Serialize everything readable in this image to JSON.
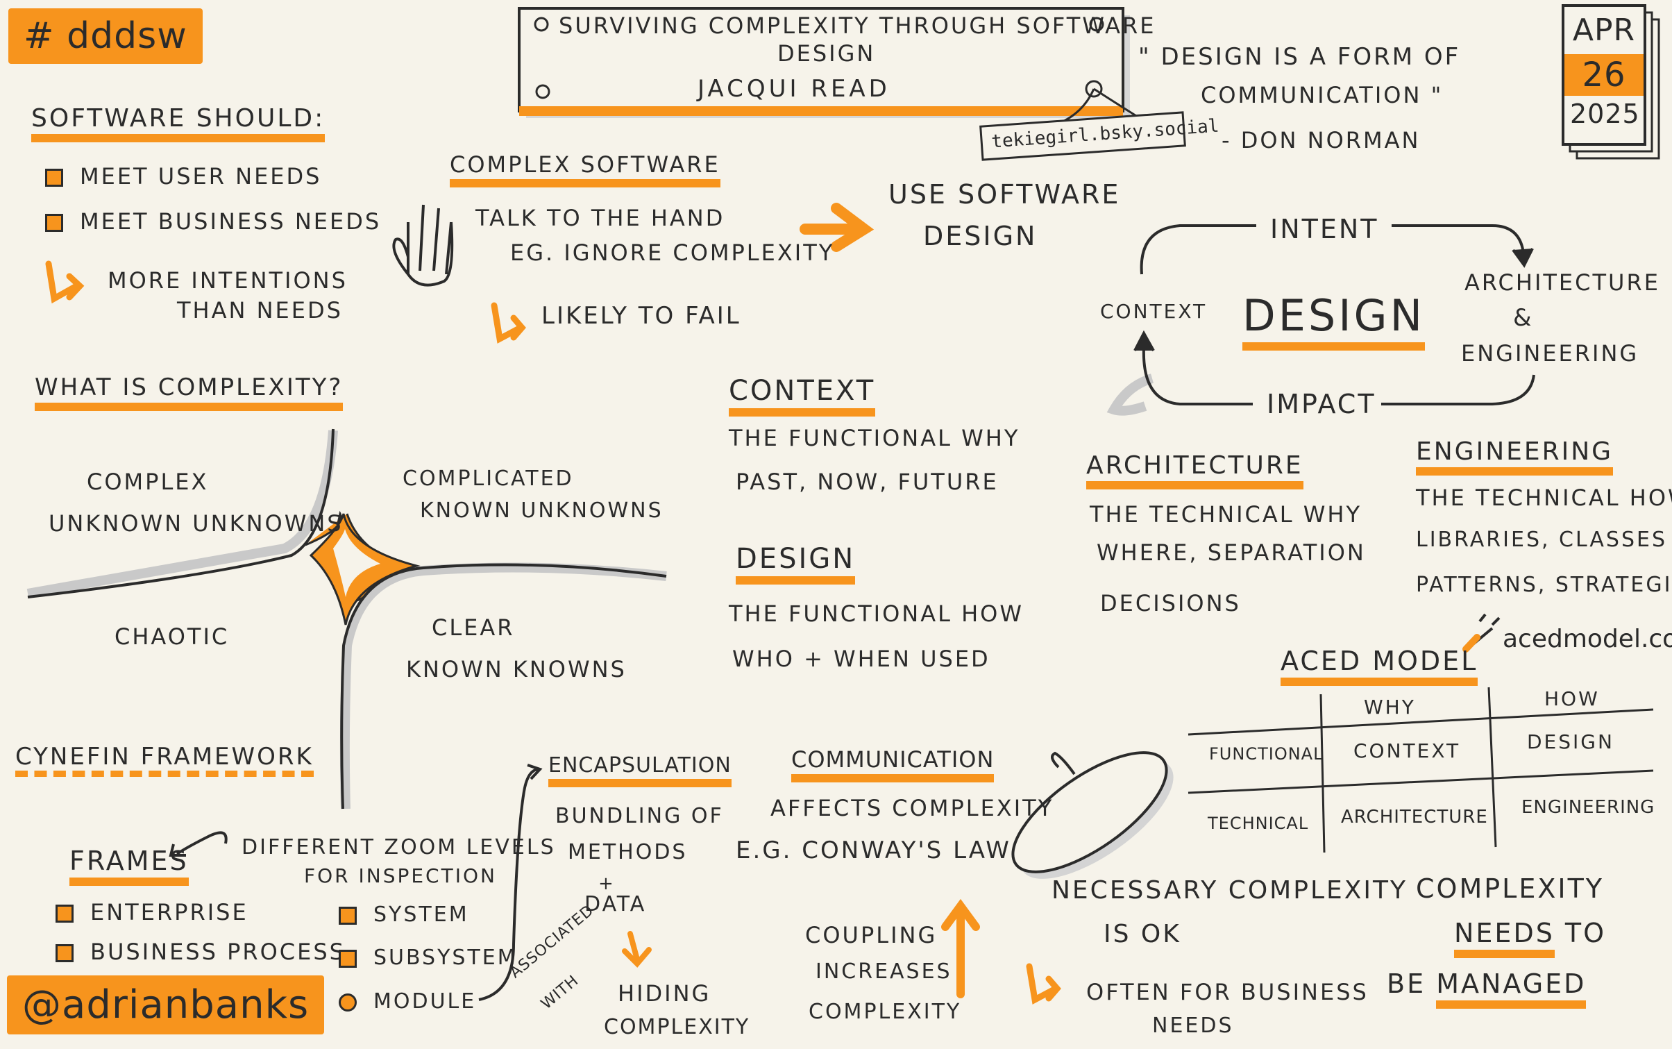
{
  "hashtag": "# dddsw",
  "handle": "@adrianbanks",
  "title": {
    "line1": "Surviving complexity through software",
    "line2": "design",
    "speaker": "Jacqui Read",
    "speaker_handle": "tekiegirl.bsky.social"
  },
  "quote": {
    "line1": "\" Design is a form of",
    "line2": "communication \"",
    "author": "- Don Norman"
  },
  "date": {
    "month": "Apr",
    "day": "26",
    "year": "2025"
  },
  "software_should": {
    "heading": "Software should:",
    "items": [
      "Meet user needs",
      "Meet business needs"
    ],
    "note_line1": "More intentions",
    "note_line2": "than needs"
  },
  "complex_software": {
    "heading": "Complex software",
    "line1": "Talk to the hand",
    "line2": "eg. Ignore complexity",
    "result": "Likely to fail",
    "arrow_text_line1": "Use software",
    "arrow_text_line2": "design"
  },
  "design_cycle": {
    "center": "Design",
    "intent": "Intent",
    "arch_line1": "Architecture",
    "arch_line2": "&",
    "arch_line3": "Engineering",
    "impact": "Impact",
    "context": "Context"
  },
  "what_is_complexity": {
    "heading": "What is complexity?",
    "complex_line1": "Complex",
    "complex_line2": "Unknown unknowns",
    "complicated_line1": "Complicated",
    "complicated_line2": "Known unknowns",
    "chaotic": "Chaotic",
    "clear_line1": "Clear",
    "clear_line2": "Known knowns",
    "framework": "Cynefin framework"
  },
  "context_section": {
    "heading": "Context",
    "line1": "The functional why",
    "line2": "Past, now, future"
  },
  "design_section": {
    "heading": "Design",
    "line1": "The functional how",
    "line2": "Who + when used"
  },
  "architecture_section": {
    "heading": "Architecture",
    "line1": "The technical why",
    "line2": "Where, separation",
    "line3": "Decisions"
  },
  "engineering_section": {
    "heading": "Engineering",
    "line1": "The technical how",
    "line2": "Libraries, classes",
    "line3": "Patterns, strategies"
  },
  "aced_model": {
    "heading": "ACED model",
    "url": "acedmodel.com",
    "col_why": "Why",
    "col_how": "How",
    "row_functional": "Functional",
    "row_technical": "Technical",
    "cell_context": "Context",
    "cell_design": "Design",
    "cell_architecture": "Architecture",
    "cell_engineering": "Engineering"
  },
  "frames": {
    "heading": "Frames",
    "note_line1": "Different zoom levels",
    "note_line2": "for inspection",
    "items_left": [
      "Enterprise",
      "Business process"
    ],
    "items_right": [
      "System",
      "Subsystem",
      "Module"
    ]
  },
  "encapsulation": {
    "heading": "Encapsulation",
    "line1": "Bundling of",
    "line2": "methods",
    "line3": "+",
    "line4": "data",
    "result_line1": "Hiding",
    "result_line2": "complexity",
    "assoc_line1": "Associated",
    "assoc_line2": "with"
  },
  "communication": {
    "heading": "Communication",
    "line1": "Affects complexity",
    "line2": "e.g. Conway's law",
    "coupling_line1": "Coupling",
    "coupling_line2": "increases",
    "coupling_line3": "complexity"
  },
  "necessary": {
    "line1": "Necessary complexity",
    "line2": "is OK",
    "note_line1": "Often for business",
    "note_line2": "needs"
  },
  "managed": {
    "line1": "Complexity",
    "line2_a": "needs",
    "line2_b": "to",
    "line3_a": "be",
    "line3_b": "managed"
  },
  "colors": {
    "accent": "#f7941d",
    "ink": "#2b2b2b",
    "paper": "#f6f3ea",
    "shadow": "#c9c9c9"
  }
}
